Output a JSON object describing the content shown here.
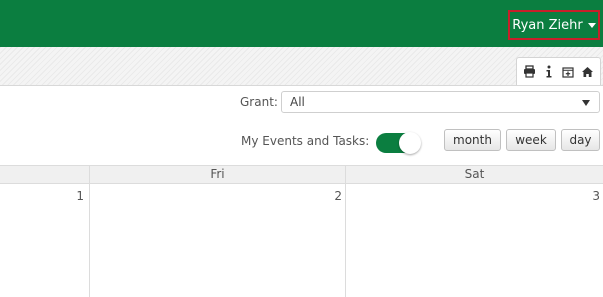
{
  "header": {
    "user_name": "Ryan Ziehr"
  },
  "toolbar": {
    "icons": [
      "print-icon",
      "info-icon",
      "calendar-add-icon",
      "home-icon"
    ]
  },
  "filters": {
    "grant_label": "Grant:",
    "grant_value": "All",
    "events_label": "My Events and Tasks:",
    "events_toggle_on": true
  },
  "views": {
    "month": "month",
    "week": "week",
    "day": "day"
  },
  "calendar": {
    "days": [
      "Fri",
      "Sat"
    ],
    "dates": [
      "1",
      "2",
      "3"
    ]
  },
  "colors": {
    "brand_green": "#0b7e40",
    "highlight_red": "#c8202a"
  }
}
